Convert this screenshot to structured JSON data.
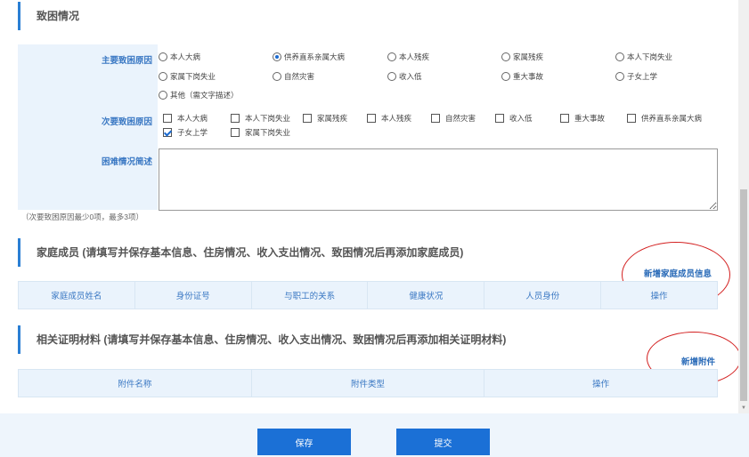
{
  "section1": {
    "title": "致困情况"
  },
  "main_cause": {
    "label": "主要致困原因",
    "options": [
      "本人大病",
      "供养直系亲属大病",
      "本人残疾",
      "家属残疾",
      "本人下岗失业",
      "家属下岗失业",
      "自然灾害",
      "收入低",
      "重大事故",
      "子女上学",
      "其他（需文字描述）"
    ],
    "selected": "供养直系亲属大病"
  },
  "secondary_cause": {
    "label": "次要致困原因",
    "options": [
      "本人大病",
      "本人下岗失业",
      "家属残疾",
      "本人残疾",
      "自然灾害",
      "收入低",
      "重大事故",
      "供养直系亲属大病",
      "子女上学",
      "家属下岗失业"
    ],
    "checked": [
      "子女上学"
    ]
  },
  "difficulty": {
    "label": "困难情况简述",
    "value": ""
  },
  "hint": "（次要致困原因最少0项，最多3项）",
  "family": {
    "title": "家庭成员",
    "subtitle": "(请填写并保存基本信息、住房情况、收入支出情况、致困情况后再添加家庭成员)",
    "add_label": "新增家庭成员信息",
    "columns": [
      "家庭成员姓名",
      "身份证号",
      "与职工的关系",
      "健康状况",
      "人员身份",
      "操作"
    ]
  },
  "docs": {
    "title": "相关证明材料",
    "subtitle": "(请填写并保存基本信息、住房情况、收入支出情况、致困情况后再添加相关证明材料)",
    "add_label": "新增附件",
    "columns": [
      "附件名称",
      "附件类型",
      "操作"
    ]
  },
  "buttons": {
    "save": "保存",
    "submit": "提交"
  },
  "colors": {
    "accent": "#1b70d6",
    "label": "#3a78c3",
    "annotation": "#d32020"
  }
}
